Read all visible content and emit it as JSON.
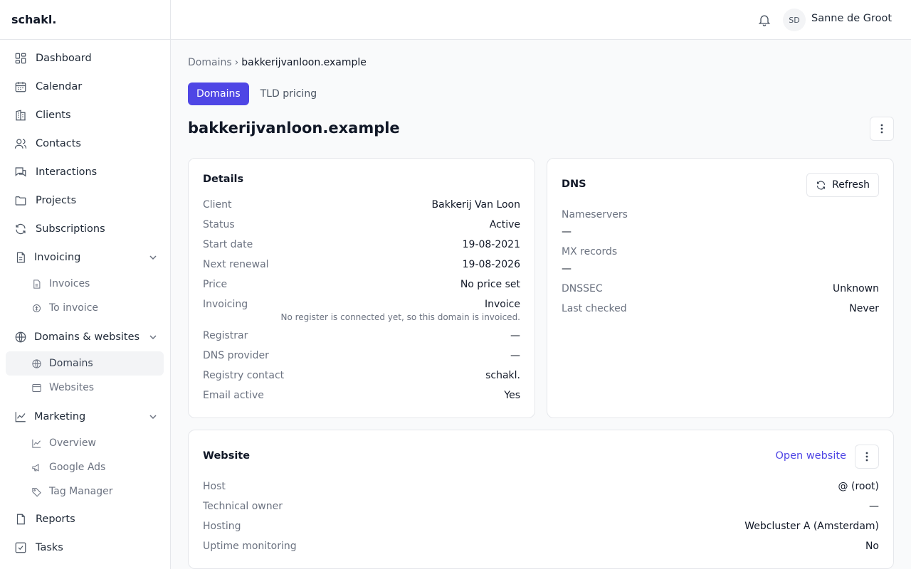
{
  "app": {
    "brand": "schakl."
  },
  "sidebar": {
    "items": [
      {
        "label": "Dashboard",
        "icon": "dashboard-icon"
      },
      {
        "label": "Calendar",
        "icon": "calendar-icon"
      },
      {
        "label": "Clients",
        "icon": "building-icon"
      },
      {
        "label": "Contacts",
        "icon": "users-icon"
      },
      {
        "label": "Interactions",
        "icon": "chat-icon"
      },
      {
        "label": "Projects",
        "icon": "folder-icon"
      },
      {
        "label": "Subscriptions",
        "icon": "refresh-icon"
      }
    ],
    "invoicing": {
      "label": "Invoicing",
      "children": [
        "Invoices",
        "To invoice"
      ]
    },
    "domains": {
      "label": "Domains & websites",
      "children": [
        "Domains",
        "Websites"
      ]
    },
    "marketing": {
      "label": "Marketing",
      "children": [
        "Overview",
        "Google Ads",
        "Tag Manager"
      ]
    },
    "bottom": [
      {
        "label": "Reports"
      },
      {
        "label": "Tasks"
      }
    ]
  },
  "topbar": {
    "initials": "SD",
    "username": "Sanne de Groot"
  },
  "breadcrumb": {
    "root": "Domains",
    "separator": "›",
    "current": "bakkerijvanloon.example"
  },
  "tabs": [
    {
      "label": "Domains",
      "active": true
    },
    {
      "label": "TLD pricing",
      "active": false
    }
  ],
  "page": {
    "title": "bakkerijvanloon.example"
  },
  "details": {
    "title": "Details",
    "rows": [
      {
        "k": "Client",
        "v": "Bakkerij Van Loon"
      },
      {
        "k": "Status",
        "v": "Active"
      },
      {
        "k": "Start date",
        "v": "19-08-2021"
      },
      {
        "k": "Next renewal",
        "v": "19-08-2026"
      },
      {
        "k": "Price",
        "v": "No price set"
      },
      {
        "k": "Invoicing",
        "v": "Invoice"
      },
      {
        "k": "Registrar",
        "v": "—"
      },
      {
        "k": "DNS provider",
        "v": "—"
      },
      {
        "k": "Registry contact",
        "v": "schakl."
      },
      {
        "k": "Email active",
        "v": "Yes"
      }
    ],
    "invoicing_note": "No register is connected yet, so this domain is invoiced."
  },
  "dns": {
    "title": "DNS",
    "refresh_label": "Refresh",
    "nameservers_label": "Nameservers",
    "nameservers_value": "—",
    "mx_label": "MX records",
    "mx_value": "—",
    "dnssec_label": "DNSSEC",
    "dnssec_value": "Unknown",
    "checked_label": "Last checked",
    "checked_value": "Never"
  },
  "website": {
    "title": "Website",
    "open_label": "Open website",
    "rows": [
      {
        "k": "Host",
        "v": "@ (root)"
      },
      {
        "k": "Technical owner",
        "v": "—"
      },
      {
        "k": "Hosting",
        "v": "Webcluster A (Amsterdam)"
      },
      {
        "k": "Uptime monitoring",
        "v": "No"
      }
    ]
  },
  "colors": {
    "accent": "#4f46e5"
  }
}
